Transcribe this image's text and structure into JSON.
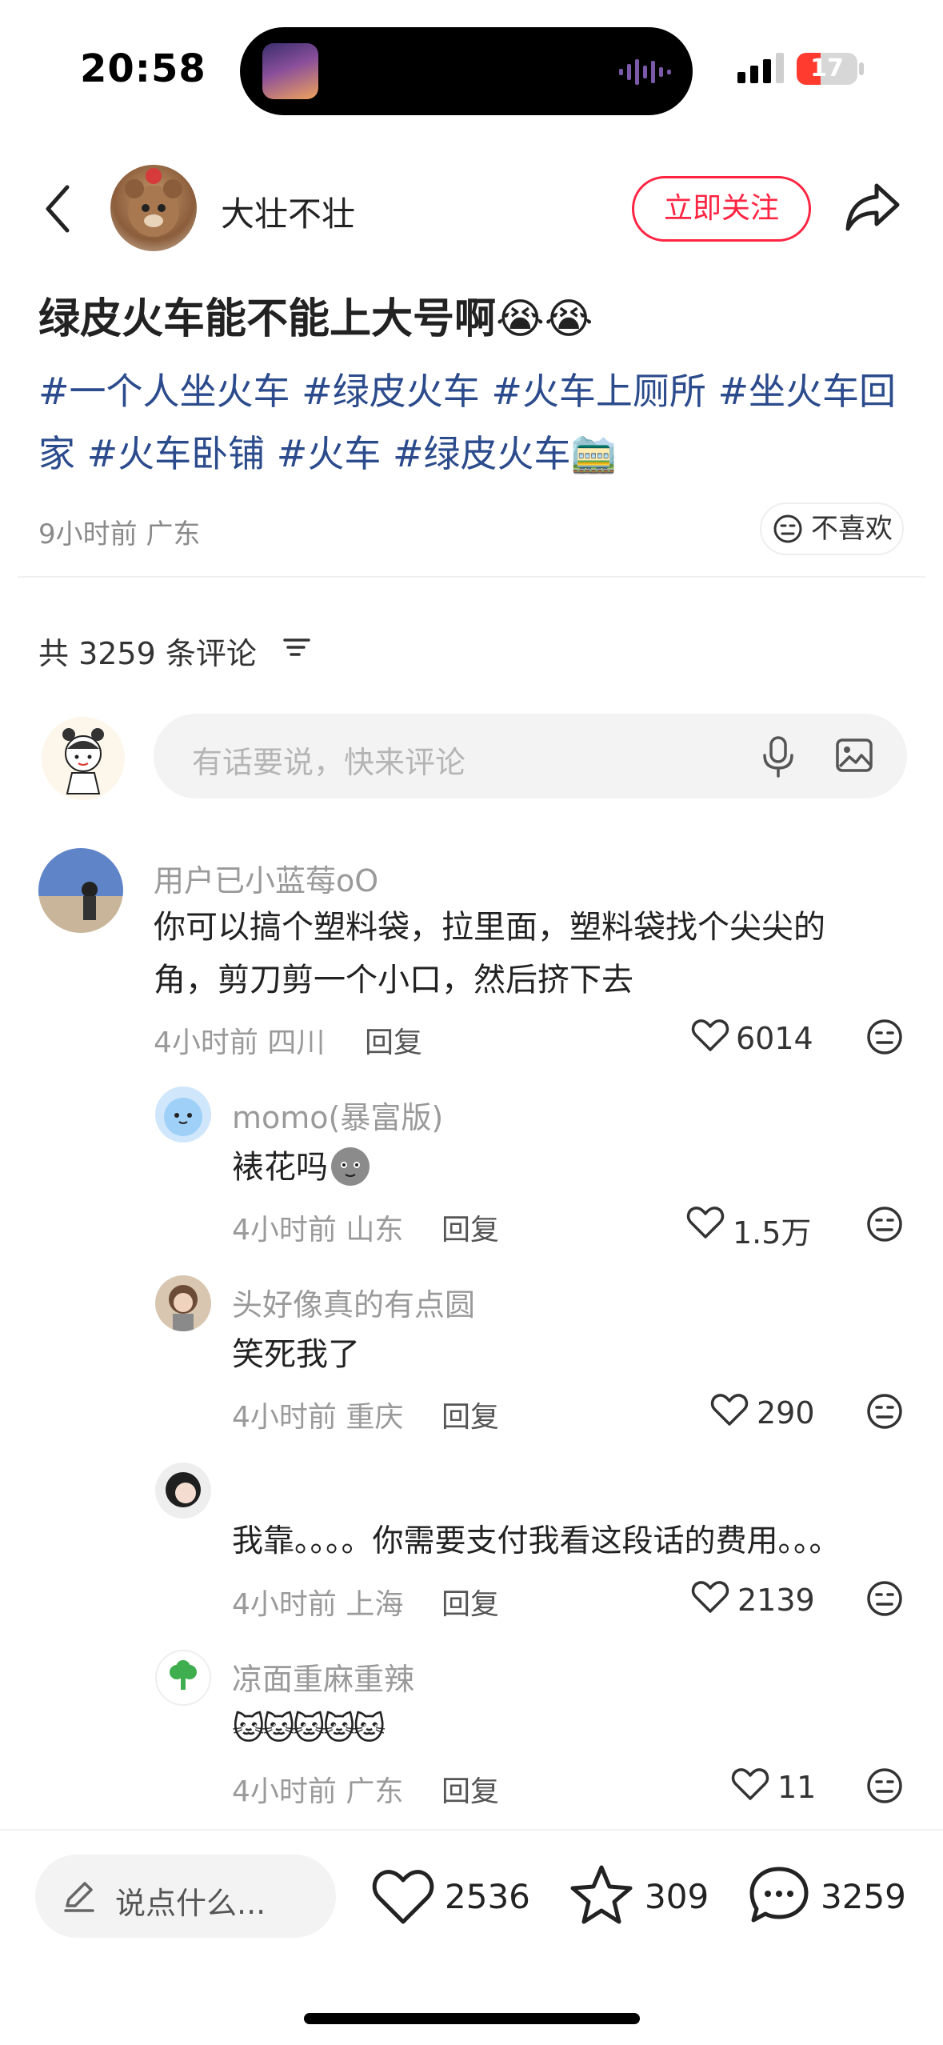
{
  "status": {
    "time": "20:58",
    "battery": "17"
  },
  "header": {
    "author": "大壮不壮",
    "follow_label": "立即关注"
  },
  "post": {
    "title": "绿皮火车能不能上大号啊😭😭",
    "tags_line1": "#一个人坐火车 #绿皮火车 #火车上厕所 #坐火车回",
    "tags_line2": "家 #火车卧铺 #火车 #绿皮火车🚞",
    "meta": "9小时前 广东",
    "dislike_label": "不喜欢"
  },
  "comments_header": {
    "count_label": "共 3259 条评论"
  },
  "comment_input": {
    "placeholder": "有话要说，快来评论"
  },
  "comments": [
    {
      "user": "用户已小蓝莓oO",
      "text1": "你可以搞个塑料袋，拉里面，塑料袋找个尖尖的",
      "text2": "角，剪刀剪一个小口，然后挤下去",
      "meta": "4小时前 四川",
      "reply": "回复",
      "likes": "6014"
    },
    {
      "user": "momo(暴富版)",
      "text1": "裱花吗",
      "meta": "4小时前 山东",
      "reply": "回复",
      "likes": "1.5万"
    },
    {
      "user": "头好像真的有点圆",
      "text1": "笑死我了",
      "meta": "4小时前 重庆",
      "reply": "回复",
      "likes": "290"
    },
    {
      "user": "",
      "text1": "我靠。。。。你需要支付我看这段话的费用。。。",
      "meta": "4小时前 上海",
      "reply": "回复",
      "likes": "2139"
    },
    {
      "user": "凉面重麻重辣",
      "text1": "🐱🐱🐱🐱🐱",
      "meta": "4小时前 广东",
      "reply": "回复",
      "likes": "11"
    }
  ],
  "bottom_bar": {
    "say_placeholder": "说点什么...",
    "likes": "2536",
    "collects": "309",
    "comments": "3259"
  },
  "colors": {
    "accent": "#ff2442",
    "tag": "#2b4b8c"
  }
}
